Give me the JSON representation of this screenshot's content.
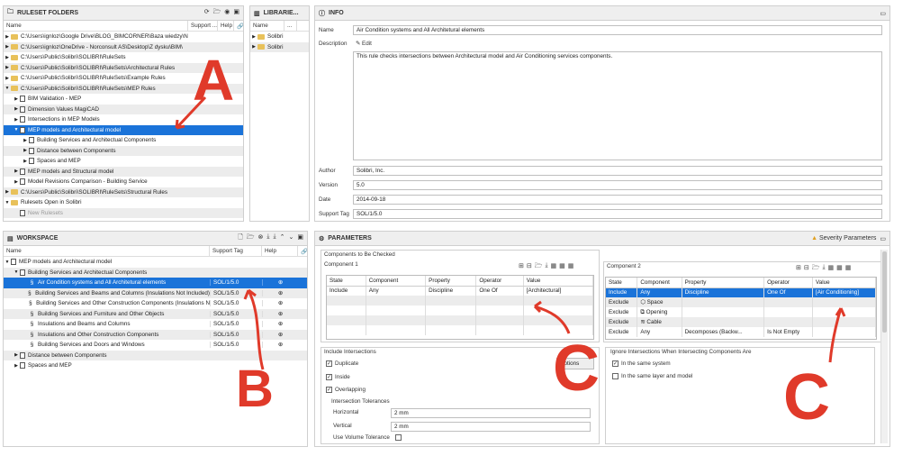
{
  "ruleset_folders": {
    "title": "RULESET FOLDERS",
    "columns": [
      "Name",
      "Support ...",
      "Help"
    ],
    "rows": [
      {
        "indent": 0,
        "tri": "▶",
        "type": "folder",
        "label": "C:\\Users\\ignloz\\Google Drive\\BLOG_BIMCORNER\\Baza wiedzy\\N",
        "alt": false
      },
      {
        "indent": 0,
        "tri": "▶",
        "type": "folder",
        "label": "C:\\Users\\ignloz\\OneDrive - Norconsult AS\\Desktop\\Z dysku\\BIM\\",
        "alt": true
      },
      {
        "indent": 0,
        "tri": "▶",
        "type": "folder",
        "label": "C:\\Users\\Public\\Solibri\\SOLIBRI\\RuleSets",
        "alt": false
      },
      {
        "indent": 0,
        "tri": "▶",
        "type": "folder",
        "label": "C:\\Users\\Public\\Solibri\\SOLIBRI\\RuleSets\\Architectural Rules",
        "alt": true
      },
      {
        "indent": 0,
        "tri": "▶",
        "type": "folder",
        "label": "C:\\Users\\Public\\Solibri\\SOLIBRI\\RuleSets\\Example Rules",
        "alt": false
      },
      {
        "indent": 0,
        "tri": "▼",
        "type": "folder",
        "label": "C:\\Users\\Public\\Solibri\\SOLIBRI\\RuleSets\\MEP Rules",
        "alt": true
      },
      {
        "indent": 1,
        "tri": "▶",
        "type": "doc",
        "label": "BIM Validation - MEP",
        "alt": false
      },
      {
        "indent": 1,
        "tri": "▶",
        "type": "doc",
        "label": "Dimension Values MagiCAD",
        "alt": true
      },
      {
        "indent": 1,
        "tri": "▶",
        "type": "doc",
        "label": "Intersections in MEP Models",
        "alt": false
      },
      {
        "indent": 1,
        "tri": "▼",
        "type": "doc",
        "label": "MEP models and Architectural model",
        "sel": true
      },
      {
        "indent": 2,
        "tri": "▶",
        "type": "doc",
        "label": "Building Services and Architectual Components",
        "alt": false
      },
      {
        "indent": 2,
        "tri": "▶",
        "type": "doc",
        "label": "Distance between Components",
        "alt": true
      },
      {
        "indent": 2,
        "tri": "▶",
        "type": "doc",
        "label": "Spaces and MEP",
        "alt": false
      },
      {
        "indent": 1,
        "tri": "▶",
        "type": "doc",
        "label": "MEP models and Structural model",
        "alt": true
      },
      {
        "indent": 1,
        "tri": "▶",
        "type": "doc",
        "label": "Model Revisions Comparison - Building Service",
        "alt": false
      },
      {
        "indent": 0,
        "tri": "▶",
        "type": "folder",
        "label": "C:\\Users\\Public\\Solibri\\SOLIBRI\\RuleSets\\Structural Rules",
        "alt": true
      },
      {
        "indent": 0,
        "tri": "▼",
        "type": "folder",
        "label": "Rulesets Open in Solibri",
        "alt": false
      },
      {
        "indent": 1,
        "tri": "",
        "type": "doc",
        "label": "New Rulesets",
        "alt": true,
        "dim": true
      }
    ]
  },
  "libraries": {
    "title": "LIBRARIE...",
    "columns": [
      "Name",
      "..."
    ],
    "rows": [
      "Solibri",
      "Solibri"
    ]
  },
  "info": {
    "title": "INFO",
    "name_label": "Name",
    "name_value": "Air Condition systems and All Architetural elements",
    "description_label": "Description",
    "edit_label": "Edit",
    "description_text": "This rule checks intersections between Architectural model and Air Conditioning services components.",
    "author_label": "Author",
    "author_value": "Solibri, Inc.",
    "version_label": "Version",
    "version_value": "5.0",
    "date_label": "Date",
    "date_value": "2014-09-18",
    "support_tag_label": "Support Tag",
    "support_tag_value": "SOL/1/5.0"
  },
  "workspace": {
    "title": "WORKSPACE",
    "columns": [
      "Name",
      "Support Tag",
      "Help"
    ],
    "rows": [
      {
        "indent": 0,
        "tri": "▼",
        "type": "doc",
        "label": "MEP models and Architectural model",
        "tag": "",
        "help": false,
        "alt": false
      },
      {
        "indent": 1,
        "tri": "▼",
        "type": "doc",
        "label": "Building Services and Architectual Components",
        "tag": "",
        "help": false,
        "alt": true
      },
      {
        "indent": 2,
        "tri": "",
        "type": "sect",
        "label": "Air Condition systems and All Architetural elements",
        "tag": "SOL/1/5.0",
        "help": true,
        "sel": true
      },
      {
        "indent": 2,
        "tri": "",
        "type": "sect",
        "label": "Building Services and Beams and Columns (Insulations Not Included)",
        "tag": "SOL/1/5.0",
        "help": true,
        "alt": true
      },
      {
        "indent": 2,
        "tri": "",
        "type": "sect",
        "label": "Building Services and Other Construction Components (Insulations N",
        "tag": "SOL/1/5.0",
        "help": true,
        "alt": false
      },
      {
        "indent": 2,
        "tri": "",
        "type": "sect",
        "label": "Building Services and Furniture and Other Objects",
        "tag": "SOL/1/5.0",
        "help": true,
        "alt": true
      },
      {
        "indent": 2,
        "tri": "",
        "type": "sect",
        "label": "Insulations and Beams and Columns",
        "tag": "SOL/1/5.0",
        "help": true,
        "alt": false
      },
      {
        "indent": 2,
        "tri": "",
        "type": "sect",
        "label": "Insulations and Other Construction Components",
        "tag": "SOL/1/5.0",
        "help": true,
        "alt": true
      },
      {
        "indent": 2,
        "tri": "",
        "type": "sect",
        "label": "Building Services and Doors and Windows",
        "tag": "SOL/1/5.0",
        "help": true,
        "alt": false
      },
      {
        "indent": 1,
        "tri": "▶",
        "type": "doc",
        "label": "Distance between Components",
        "tag": "",
        "help": false,
        "alt": true
      },
      {
        "indent": 1,
        "tri": "▶",
        "type": "doc",
        "label": "Spaces and MEP",
        "tag": "",
        "help": false,
        "alt": false
      }
    ]
  },
  "parameters": {
    "title": "PARAMETERS",
    "severity_label": "Severity Parameters",
    "components_to_check": "Components to Be Checked",
    "component1": {
      "title": "Component 1",
      "columns": [
        "State",
        "Component",
        "Property",
        "Operator",
        "Value"
      ],
      "rows": [
        [
          "Include",
          "Any",
          "Discipline",
          "One Of",
          "[Architectural]"
        ]
      ]
    },
    "component2": {
      "title": "Component 2",
      "columns": [
        "State",
        "Component",
        "Property",
        "Operator",
        "Value"
      ],
      "rows": [
        [
          "Include",
          "Any",
          "Discipline",
          "One Of",
          "[Air Conditioning]"
        ],
        [
          "Exclude",
          "Space",
          "",
          "",
          ""
        ],
        [
          "Exclude",
          "Opening",
          "",
          "",
          ""
        ],
        [
          "Exclude",
          "Cable",
          "",
          "",
          ""
        ],
        [
          "Exclude",
          "Any",
          "Decomposes (Backw...",
          "Is Not Empty",
          ""
        ]
      ]
    },
    "include_intersections": {
      "title": "Include Intersections",
      "duplicate": "Duplicate",
      "inside": "Inside",
      "overlapping": "Overlapping",
      "exceptions_button": "eptions",
      "tolerances_title": "Intersection Tolerances",
      "horizontal_label": "Horizontal",
      "horizontal_value": "2 mm",
      "vertical_label": "Vertical",
      "vertical_value": "2 mm",
      "volume_label": "Use Volume Tolerance"
    },
    "ignore_intersections": {
      "title": "Ignore Intersections When Intersecting Components Are",
      "same_system": "In the same system",
      "same_layer": "In the same layer and model"
    }
  },
  "annotations": {
    "a": "A",
    "b": "B",
    "c1": "C",
    "c2": "C"
  },
  "colors": {
    "selection": "#1a73d9",
    "annotation": "#e03a2a",
    "folder": "#e8c15a"
  }
}
